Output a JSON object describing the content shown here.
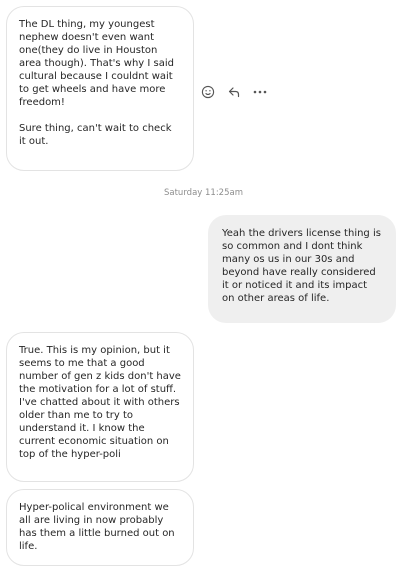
{
  "messages": [
    {
      "sender": "them",
      "text": "The DL thing, my youngest nephew doesn't even want one(they do live in Houston area though). That's why I said cultural because I couldnt wait to get wheels and have more freedom!\n\nSure thing, can't wait to check it out."
    },
    {
      "sender": "me",
      "text": "Yeah the drivers license thing is so common and I dont think many os us in our 30s and beyond have really considered it or noticed it and its impact on other areas of life."
    },
    {
      "sender": "them",
      "text": "True. This is my opinion, but it seems to me that a good number of gen z kids don't have the motivation for a lot of stuff. I've chatted about it with others older than me to try to understand it. I know the current economic situation on top of the hyper-poli"
    },
    {
      "sender": "them",
      "text": "Hyper-polical environment we all are living in now probably has them a little burned out on life."
    }
  ],
  "timestamp": "Saturday 11:25am",
  "hover_actions": {
    "react_icon": "emoji-icon",
    "reply_icon": "reply-arrow-icon",
    "more_icon": "more-dots-icon"
  },
  "colors": {
    "incoming_border": "#e3e3e3",
    "outgoing_bg": "#efefef",
    "timestamp": "#8e8e8e",
    "text": "#262626"
  }
}
